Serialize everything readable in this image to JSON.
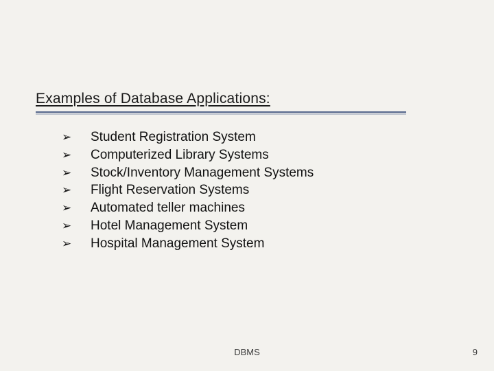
{
  "title": "Examples of Database Applications:",
  "bullet_glyph": "➢",
  "items": [
    "Student Registration System",
    "Computerized Library Systems",
    "Stock/Inventory Management Systems",
    "Flight Reservation Systems",
    "Automated teller machines",
    "Hotel Management System",
    "Hospital Management System"
  ],
  "footer_center": "DBMS",
  "page_number": "9"
}
